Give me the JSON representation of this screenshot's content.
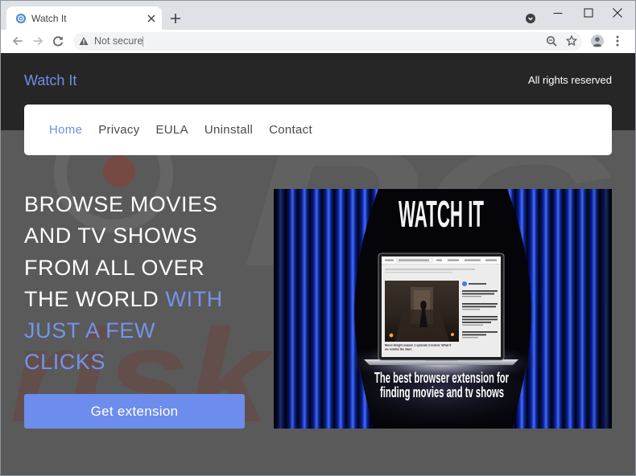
{
  "browser": {
    "tab_title": "Watch It",
    "security_label": "Not secure",
    "icons": [
      "favicon-icon",
      "close-icon",
      "plus-icon",
      "tab-search-icon",
      "minimize-icon",
      "maximize-icon",
      "window-close-icon",
      "back-arrow-icon",
      "forward-arrow-icon",
      "reload-icon",
      "warning-icon",
      "zoom-icon",
      "star-icon",
      "profile-icon",
      "menu-icon"
    ]
  },
  "header": {
    "logo": "Watch It",
    "rights": "All rights reserved"
  },
  "nav": {
    "items": [
      {
        "label": "Home",
        "active": true
      },
      {
        "label": "Privacy"
      },
      {
        "label": "EULA"
      },
      {
        "label": "Uninstall"
      },
      {
        "label": "Contact"
      }
    ]
  },
  "hero": {
    "white_lines": [
      "BROWSE MOVIES",
      "AND TV SHOWS",
      "FROM ALL OVER",
      "THE WORLD"
    ],
    "accent_lines": [
      "WITH",
      "JUST A FEW",
      "CLICKS"
    ],
    "cta": "Get extension"
  },
  "promo": {
    "title": "WATCH IT",
    "caption_lines": [
      "The best browser extension for",
      "finding movies and tv shows"
    ],
    "laptop_article_caption": [
      "Moon Knight season 1 episode 3 review: What if",
      "we rewrite the stars"
    ]
  },
  "watermark": {
    "line1": "PC",
    "line2": "risk.com"
  },
  "colors": {
    "accent": "#6f8ee6",
    "header_bg": "#262626",
    "page_bg": "#5a5a5a",
    "button": "#6d8ded",
    "tabstrip": "#dee1e6"
  }
}
